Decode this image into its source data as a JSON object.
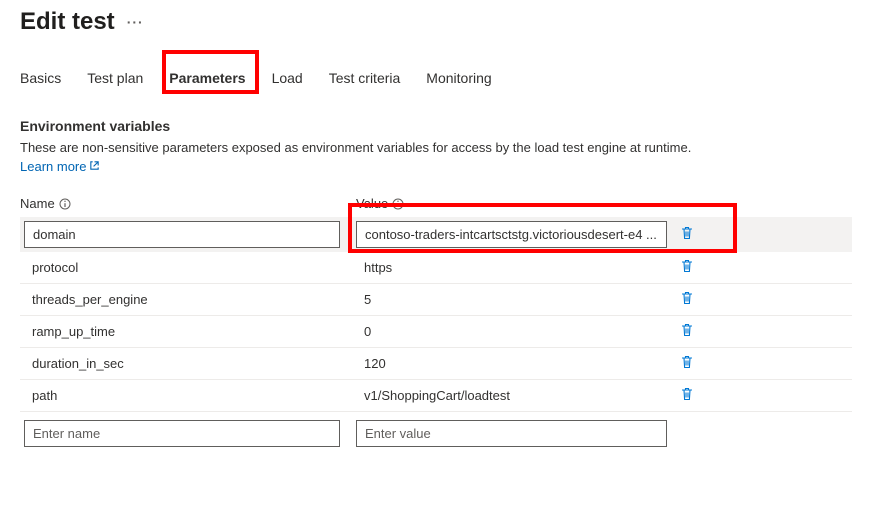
{
  "header": {
    "title": "Edit test"
  },
  "tabs": {
    "items": [
      {
        "label": "Basics"
      },
      {
        "label": "Test plan"
      },
      {
        "label": "Parameters"
      },
      {
        "label": "Load"
      },
      {
        "label": "Test criteria"
      },
      {
        "label": "Monitoring"
      }
    ]
  },
  "section": {
    "title": "Environment variables",
    "description": "These are non-sensitive parameters exposed as environment variables for access by the load test engine at runtime.",
    "learn_more": "Learn more"
  },
  "columns": {
    "name": "Name",
    "value": "Value"
  },
  "env_rows": [
    {
      "name": "domain",
      "value": "contoso-traders-intcartsctstg.victoriousdesert-e4 ..."
    },
    {
      "name": "protocol",
      "value": "https"
    },
    {
      "name": "threads_per_engine",
      "value": "5"
    },
    {
      "name": "ramp_up_time",
      "value": "0"
    },
    {
      "name": "duration_in_sec",
      "value": "120"
    },
    {
      "name": "path",
      "value": "v1/ShoppingCart/loadtest"
    }
  ],
  "placeholders": {
    "name": "Enter name",
    "value": "Enter value"
  }
}
